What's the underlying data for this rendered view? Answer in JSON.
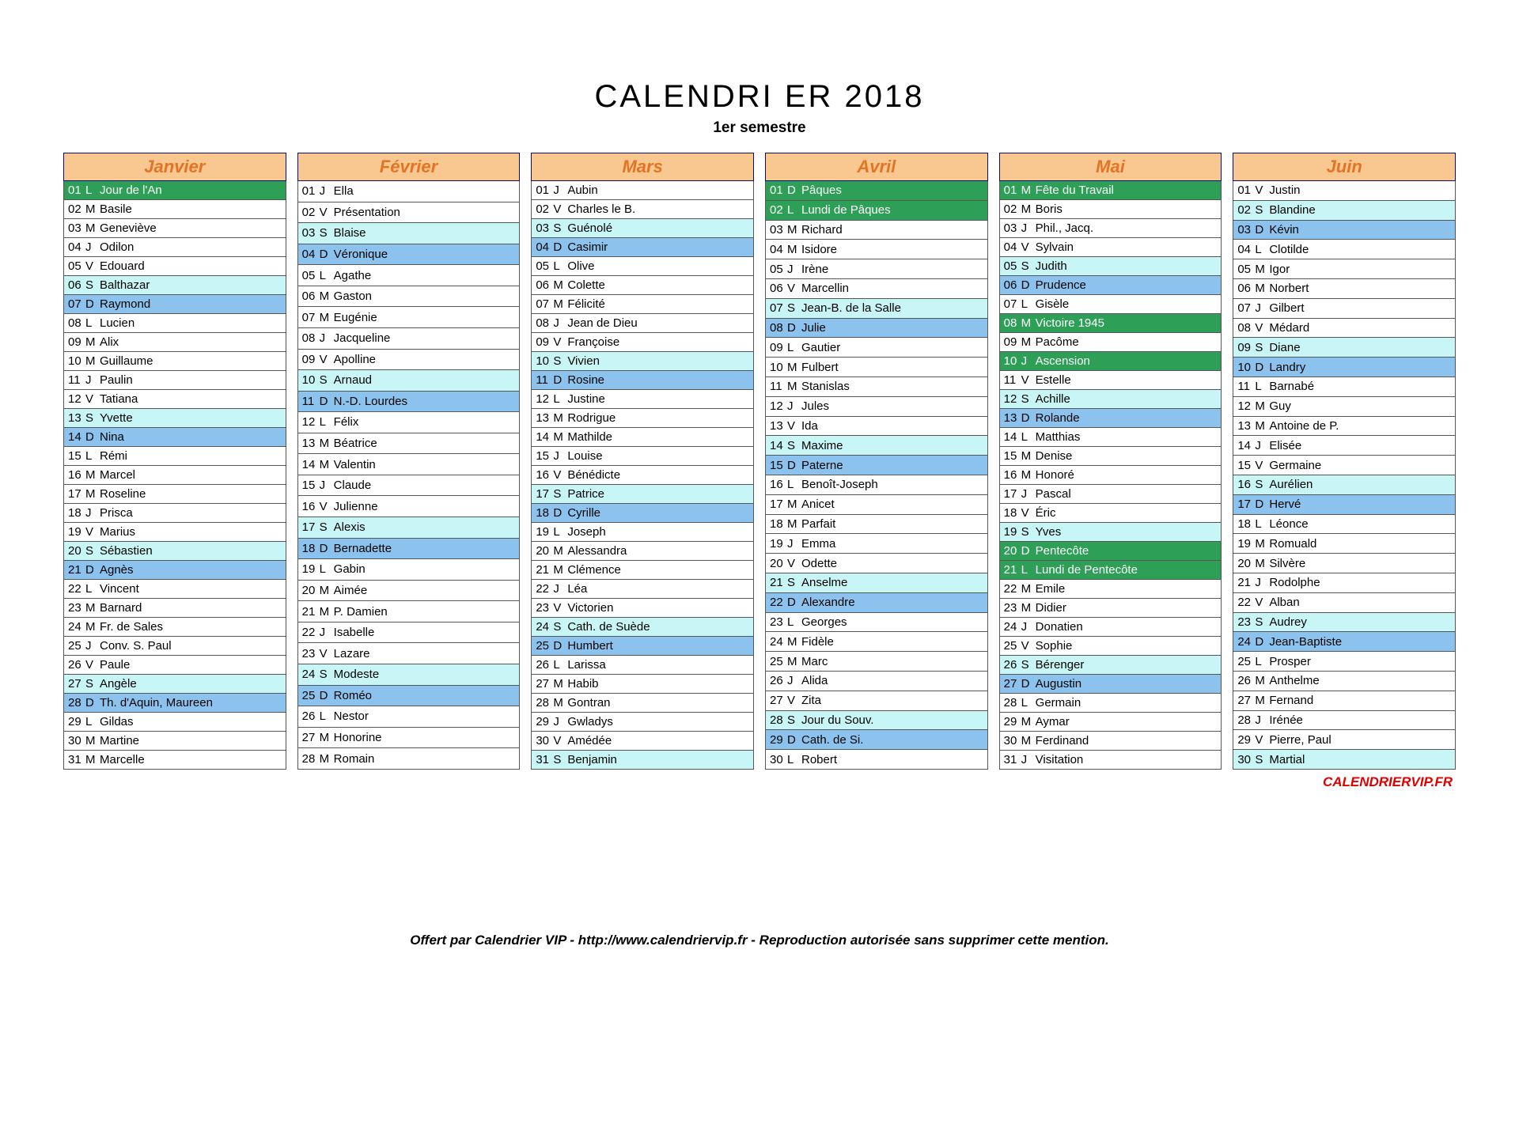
{
  "title": "CALENDRI ER 2018",
  "subtitle": "1er semestre",
  "brand": "CALENDRIERVIP.FR",
  "footer": "Offert par Calendrier VIP - http://www.calendriervip.fr - Reproduction autorisée sans supprimer cette mention.",
  "months": [
    {
      "name": "Janvier",
      "days": [
        {
          "n": "01",
          "d": "L",
          "t": "Jour de l'An",
          "c": "hol"
        },
        {
          "n": "02",
          "d": "M",
          "t": "Basile"
        },
        {
          "n": "03",
          "d": "M",
          "t": "Geneviève"
        },
        {
          "n": "04",
          "d": "J",
          "t": "Odilon"
        },
        {
          "n": "05",
          "d": "V",
          "t": "Edouard"
        },
        {
          "n": "06",
          "d": "S",
          "t": "Balthazar",
          "c": "sat"
        },
        {
          "n": "07",
          "d": "D",
          "t": "Raymond",
          "c": "sun"
        },
        {
          "n": "08",
          "d": "L",
          "t": "Lucien"
        },
        {
          "n": "09",
          "d": "M",
          "t": "Alix"
        },
        {
          "n": "10",
          "d": "M",
          "t": "Guillaume"
        },
        {
          "n": "11",
          "d": "J",
          "t": "Paulin"
        },
        {
          "n": "12",
          "d": "V",
          "t": "Tatiana"
        },
        {
          "n": "13",
          "d": "S",
          "t": "Yvette",
          "c": "sat"
        },
        {
          "n": "14",
          "d": "D",
          "t": "Nina",
          "c": "sun"
        },
        {
          "n": "15",
          "d": "L",
          "t": "Rémi"
        },
        {
          "n": "16",
          "d": "M",
          "t": "Marcel"
        },
        {
          "n": "17",
          "d": "M",
          "t": "Roseline"
        },
        {
          "n": "18",
          "d": "J",
          "t": "Prisca"
        },
        {
          "n": "19",
          "d": "V",
          "t": "Marius"
        },
        {
          "n": "20",
          "d": "S",
          "t": "Sébastien",
          "c": "sat"
        },
        {
          "n": "21",
          "d": "D",
          "t": "Agnès",
          "c": "sun"
        },
        {
          "n": "22",
          "d": "L",
          "t": "Vincent"
        },
        {
          "n": "23",
          "d": "M",
          "t": "Barnard"
        },
        {
          "n": "24",
          "d": "M",
          "t": "Fr. de Sales"
        },
        {
          "n": "25",
          "d": "J",
          "t": "Conv. S. Paul"
        },
        {
          "n": "26",
          "d": "V",
          "t": "Paule"
        },
        {
          "n": "27",
          "d": "S",
          "t": "Angèle",
          "c": "sat"
        },
        {
          "n": "28",
          "d": "D",
          "t": "Th. d'Aquin, Maureen",
          "c": "sun"
        },
        {
          "n": "29",
          "d": "L",
          "t": "Gildas"
        },
        {
          "n": "30",
          "d": "M",
          "t": "Martine"
        },
        {
          "n": "31",
          "d": "M",
          "t": "Marcelle"
        }
      ]
    },
    {
      "name": "Février",
      "days": [
        {
          "n": "01",
          "d": "J",
          "t": "Ella"
        },
        {
          "n": "02",
          "d": "V",
          "t": "Présentation"
        },
        {
          "n": "03",
          "d": "S",
          "t": "Blaise",
          "c": "sat"
        },
        {
          "n": "04",
          "d": "D",
          "t": "Véronique",
          "c": "sun"
        },
        {
          "n": "05",
          "d": "L",
          "t": "Agathe"
        },
        {
          "n": "06",
          "d": "M",
          "t": "Gaston"
        },
        {
          "n": "07",
          "d": "M",
          "t": "Eugénie"
        },
        {
          "n": "08",
          "d": "J",
          "t": "Jacqueline"
        },
        {
          "n": "09",
          "d": "V",
          "t": "Apolline"
        },
        {
          "n": "10",
          "d": "S",
          "t": "Arnaud",
          "c": "sat"
        },
        {
          "n": "11",
          "d": "D",
          "t": "N.-D. Lourdes",
          "c": "sun"
        },
        {
          "n": "12",
          "d": "L",
          "t": "Félix"
        },
        {
          "n": "13",
          "d": "M",
          "t": "Béatrice"
        },
        {
          "n": "14",
          "d": "M",
          "t": "Valentin"
        },
        {
          "n": "15",
          "d": "J",
          "t": "Claude"
        },
        {
          "n": "16",
          "d": "V",
          "t": "Julienne"
        },
        {
          "n": "17",
          "d": "S",
          "t": "Alexis",
          "c": "sat"
        },
        {
          "n": "18",
          "d": "D",
          "t": "Bernadette",
          "c": "sun"
        },
        {
          "n": "19",
          "d": "L",
          "t": "Gabin"
        },
        {
          "n": "20",
          "d": "M",
          "t": "Aimée"
        },
        {
          "n": "21",
          "d": "M",
          "t": "P. Damien"
        },
        {
          "n": "22",
          "d": "J",
          "t": "Isabelle"
        },
        {
          "n": "23",
          "d": "V",
          "t": "Lazare"
        },
        {
          "n": "24",
          "d": "S",
          "t": "Modeste",
          "c": "sat"
        },
        {
          "n": "25",
          "d": "D",
          "t": "Roméo",
          "c": "sun"
        },
        {
          "n": "26",
          "d": "L",
          "t": "Nestor"
        },
        {
          "n": "27",
          "d": "M",
          "t": "Honorine"
        },
        {
          "n": "28",
          "d": "M",
          "t": "Romain"
        }
      ]
    },
    {
      "name": "Mars",
      "days": [
        {
          "n": "01",
          "d": "J",
          "t": "Aubin"
        },
        {
          "n": "02",
          "d": "V",
          "t": "Charles le B."
        },
        {
          "n": "03",
          "d": "S",
          "t": "Guénolé",
          "c": "sat"
        },
        {
          "n": "04",
          "d": "D",
          "t": "Casimir",
          "c": "sun"
        },
        {
          "n": "05",
          "d": "L",
          "t": "Olive"
        },
        {
          "n": "06",
          "d": "M",
          "t": "Colette"
        },
        {
          "n": "07",
          "d": "M",
          "t": "Félicité"
        },
        {
          "n": "08",
          "d": "J",
          "t": "Jean de Dieu"
        },
        {
          "n": "09",
          "d": "V",
          "t": "Françoise"
        },
        {
          "n": "10",
          "d": "S",
          "t": "Vivien",
          "c": "sat"
        },
        {
          "n": "11",
          "d": "D",
          "t": "Rosine",
          "c": "sun"
        },
        {
          "n": "12",
          "d": "L",
          "t": "Justine"
        },
        {
          "n": "13",
          "d": "M",
          "t": "Rodrigue"
        },
        {
          "n": "14",
          "d": "M",
          "t": "Mathilde"
        },
        {
          "n": "15",
          "d": "J",
          "t": "Louise"
        },
        {
          "n": "16",
          "d": "V",
          "t": "Bénédicte"
        },
        {
          "n": "17",
          "d": "S",
          "t": "Patrice",
          "c": "sat"
        },
        {
          "n": "18",
          "d": "D",
          "t": "Cyrille",
          "c": "sun"
        },
        {
          "n": "19",
          "d": "L",
          "t": "Joseph"
        },
        {
          "n": "20",
          "d": "M",
          "t": "Alessandra"
        },
        {
          "n": "21",
          "d": "M",
          "t": "Clémence"
        },
        {
          "n": "22",
          "d": "J",
          "t": "Léa"
        },
        {
          "n": "23",
          "d": "V",
          "t": "Victorien"
        },
        {
          "n": "24",
          "d": "S",
          "t": "Cath. de Suède",
          "c": "sat"
        },
        {
          "n": "25",
          "d": "D",
          "t": "Humbert",
          "c": "sun"
        },
        {
          "n": "26",
          "d": "L",
          "t": "Larissa"
        },
        {
          "n": "27",
          "d": "M",
          "t": "Habib"
        },
        {
          "n": "28",
          "d": "M",
          "t": "Gontran"
        },
        {
          "n": "29",
          "d": "J",
          "t": "Gwladys"
        },
        {
          "n": "30",
          "d": "V",
          "t": "Amédée"
        },
        {
          "n": "31",
          "d": "S",
          "t": "Benjamin",
          "c": "sat"
        }
      ]
    },
    {
      "name": "Avril",
      "days": [
        {
          "n": "01",
          "d": "D",
          "t": "Pâques",
          "c": "hol"
        },
        {
          "n": "02",
          "d": "L",
          "t": "Lundi de Pâques",
          "c": "hol"
        },
        {
          "n": "03",
          "d": "M",
          "t": "Richard"
        },
        {
          "n": "04",
          "d": "M",
          "t": "Isidore"
        },
        {
          "n": "05",
          "d": "J",
          "t": "Irène"
        },
        {
          "n": "06",
          "d": "V",
          "t": "Marcellin"
        },
        {
          "n": "07",
          "d": "S",
          "t": "Jean-B. de la Salle",
          "c": "sat"
        },
        {
          "n": "08",
          "d": "D",
          "t": "Julie",
          "c": "sun"
        },
        {
          "n": "09",
          "d": "L",
          "t": "Gautier"
        },
        {
          "n": "10",
          "d": "M",
          "t": "Fulbert"
        },
        {
          "n": "11",
          "d": "M",
          "t": "Stanislas"
        },
        {
          "n": "12",
          "d": "J",
          "t": "Jules"
        },
        {
          "n": "13",
          "d": "V",
          "t": "Ida"
        },
        {
          "n": "14",
          "d": "S",
          "t": "Maxime",
          "c": "sat"
        },
        {
          "n": "15",
          "d": "D",
          "t": "Paterne",
          "c": "sun"
        },
        {
          "n": "16",
          "d": "L",
          "t": "Benoît-Joseph"
        },
        {
          "n": "17",
          "d": "M",
          "t": "Anicet"
        },
        {
          "n": "18",
          "d": "M",
          "t": "Parfait"
        },
        {
          "n": "19",
          "d": "J",
          "t": "Emma"
        },
        {
          "n": "20",
          "d": "V",
          "t": "Odette"
        },
        {
          "n": "21",
          "d": "S",
          "t": "Anselme",
          "c": "sat"
        },
        {
          "n": "22",
          "d": "D",
          "t": "Alexandre",
          "c": "sun"
        },
        {
          "n": "23",
          "d": "L",
          "t": "Georges"
        },
        {
          "n": "24",
          "d": "M",
          "t": "Fidèle"
        },
        {
          "n": "25",
          "d": "M",
          "t": "Marc"
        },
        {
          "n": "26",
          "d": "J",
          "t": "Alida"
        },
        {
          "n": "27",
          "d": "V",
          "t": "Zita"
        },
        {
          "n": "28",
          "d": "S",
          "t": "Jour du Souv.",
          "c": "sat"
        },
        {
          "n": "29",
          "d": "D",
          "t": "Cath. de Si.",
          "c": "sun"
        },
        {
          "n": "30",
          "d": "L",
          "t": "Robert"
        }
      ]
    },
    {
      "name": "Mai",
      "days": [
        {
          "n": "01",
          "d": "M",
          "t": "Fête du Travail",
          "c": "hol"
        },
        {
          "n": "02",
          "d": "M",
          "t": "Boris"
        },
        {
          "n": "03",
          "d": "J",
          "t": "Phil., Jacq."
        },
        {
          "n": "04",
          "d": "V",
          "t": "Sylvain"
        },
        {
          "n": "05",
          "d": "S",
          "t": "Judith",
          "c": "sat"
        },
        {
          "n": "06",
          "d": "D",
          "t": "Prudence",
          "c": "sun"
        },
        {
          "n": "07",
          "d": "L",
          "t": "Gisèle"
        },
        {
          "n": "08",
          "d": "M",
          "t": "Victoire 1945",
          "c": "hol"
        },
        {
          "n": "09",
          "d": "M",
          "t": "Pacôme"
        },
        {
          "n": "10",
          "d": "J",
          "t": "Ascension",
          "c": "hol"
        },
        {
          "n": "11",
          "d": "V",
          "t": "Estelle"
        },
        {
          "n": "12",
          "d": "S",
          "t": "Achille",
          "c": "sat"
        },
        {
          "n": "13",
          "d": "D",
          "t": "Rolande",
          "c": "sun"
        },
        {
          "n": "14",
          "d": "L",
          "t": "Matthias"
        },
        {
          "n": "15",
          "d": "M",
          "t": "Denise"
        },
        {
          "n": "16",
          "d": "M",
          "t": "Honoré"
        },
        {
          "n": "17",
          "d": "J",
          "t": "Pascal"
        },
        {
          "n": "18",
          "d": "V",
          "t": "Éric"
        },
        {
          "n": "19",
          "d": "S",
          "t": "Yves",
          "c": "sat"
        },
        {
          "n": "20",
          "d": "D",
          "t": "Pentecôte",
          "c": "hol"
        },
        {
          "n": "21",
          "d": "L",
          "t": "Lundi de Pentecôte",
          "c": "hol"
        },
        {
          "n": "22",
          "d": "M",
          "t": "Emile"
        },
        {
          "n": "23",
          "d": "M",
          "t": "Didier"
        },
        {
          "n": "24",
          "d": "J",
          "t": "Donatien"
        },
        {
          "n": "25",
          "d": "V",
          "t": "Sophie"
        },
        {
          "n": "26",
          "d": "S",
          "t": "Bérenger",
          "c": "sat"
        },
        {
          "n": "27",
          "d": "D",
          "t": "Augustin",
          "c": "sun"
        },
        {
          "n": "28",
          "d": "L",
          "t": "Germain"
        },
        {
          "n": "29",
          "d": "M",
          "t": "Aymar"
        },
        {
          "n": "30",
          "d": "M",
          "t": "Ferdinand"
        },
        {
          "n": "31",
          "d": "J",
          "t": "Visitation"
        }
      ]
    },
    {
      "name": "Juin",
      "days": [
        {
          "n": "01",
          "d": "V",
          "t": "Justin"
        },
        {
          "n": "02",
          "d": "S",
          "t": "Blandine",
          "c": "sat"
        },
        {
          "n": "03",
          "d": "D",
          "t": "Kévin",
          "c": "sun"
        },
        {
          "n": "04",
          "d": "L",
          "t": "Clotilde"
        },
        {
          "n": "05",
          "d": "M",
          "t": "Igor"
        },
        {
          "n": "06",
          "d": "M",
          "t": "Norbert"
        },
        {
          "n": "07",
          "d": "J",
          "t": "Gilbert"
        },
        {
          "n": "08",
          "d": "V",
          "t": "Médard"
        },
        {
          "n": "09",
          "d": "S",
          "t": "Diane",
          "c": "sat"
        },
        {
          "n": "10",
          "d": "D",
          "t": "Landry",
          "c": "sun"
        },
        {
          "n": "11",
          "d": "L",
          "t": "Barnabé"
        },
        {
          "n": "12",
          "d": "M",
          "t": "Guy"
        },
        {
          "n": "13",
          "d": "M",
          "t": "Antoine de P."
        },
        {
          "n": "14",
          "d": "J",
          "t": "Elisée"
        },
        {
          "n": "15",
          "d": "V",
          "t": "Germaine"
        },
        {
          "n": "16",
          "d": "S",
          "t": "Aurélien",
          "c": "sat"
        },
        {
          "n": "17",
          "d": "D",
          "t": "Hervé",
          "c": "sun"
        },
        {
          "n": "18",
          "d": "L",
          "t": "Léonce"
        },
        {
          "n": "19",
          "d": "M",
          "t": "Romuald"
        },
        {
          "n": "20",
          "d": "M",
          "t": "Silvère"
        },
        {
          "n": "21",
          "d": "J",
          "t": "Rodolphe"
        },
        {
          "n": "22",
          "d": "V",
          "t": "Alban"
        },
        {
          "n": "23",
          "d": "S",
          "t": "Audrey",
          "c": "sat"
        },
        {
          "n": "24",
          "d": "D",
          "t": "Jean-Baptiste",
          "c": "sun"
        },
        {
          "n": "25",
          "d": "L",
          "t": "Prosper"
        },
        {
          "n": "26",
          "d": "M",
          "t": "Anthelme"
        },
        {
          "n": "27",
          "d": "M",
          "t": "Fernand"
        },
        {
          "n": "28",
          "d": "J",
          "t": "Irénée"
        },
        {
          "n": "29",
          "d": "V",
          "t": "Pierre, Paul"
        },
        {
          "n": "30",
          "d": "S",
          "t": "Martial",
          "c": "sat"
        }
      ]
    }
  ]
}
